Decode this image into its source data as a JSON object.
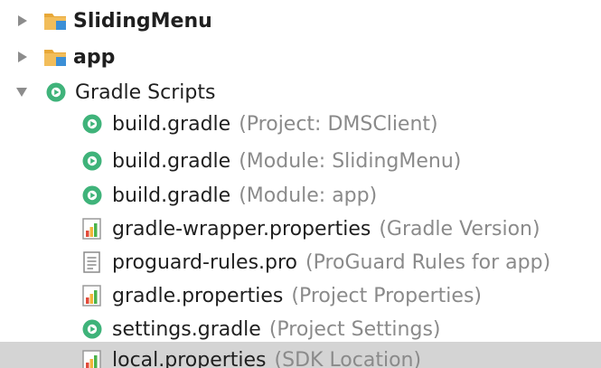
{
  "tree": {
    "items": [
      {
        "name": "SlidingMenu",
        "hint": "",
        "icon": "module-folder-icon",
        "expanded": false
      },
      {
        "name": "app",
        "hint": "",
        "icon": "module-folder-icon",
        "expanded": false
      },
      {
        "name": "Gradle Scripts",
        "hint": "",
        "icon": "gradle-icon",
        "expanded": true
      },
      {
        "name": "build.gradle",
        "hint": "(Project: DMSClient)",
        "icon": "gradle-icon"
      },
      {
        "name": "build.gradle",
        "hint": "(Module: SlidingMenu)",
        "icon": "gradle-icon"
      },
      {
        "name": "build.gradle",
        "hint": "(Module: app)",
        "icon": "gradle-icon"
      },
      {
        "name": "gradle-wrapper.properties",
        "hint": "(Gradle Version)",
        "icon": "properties-file-icon"
      },
      {
        "name": "proguard-rules.pro",
        "hint": "(ProGuard Rules for app)",
        "icon": "text-file-icon"
      },
      {
        "name": "gradle.properties",
        "hint": "(Project Properties)",
        "icon": "properties-file-icon"
      },
      {
        "name": "settings.gradle",
        "hint": "(Project Settings)",
        "icon": "gradle-icon"
      },
      {
        "name": "local.properties",
        "hint": "(SDK Location)",
        "icon": "properties-file-icon",
        "selected": true
      }
    ]
  },
  "colors": {
    "gradle_green": "#3fb37a",
    "folder_orange": "#e8a838",
    "module_blue": "#3c8fd6",
    "hint_gray": "#8a8a8a",
    "selection": "#d4d4d4"
  }
}
